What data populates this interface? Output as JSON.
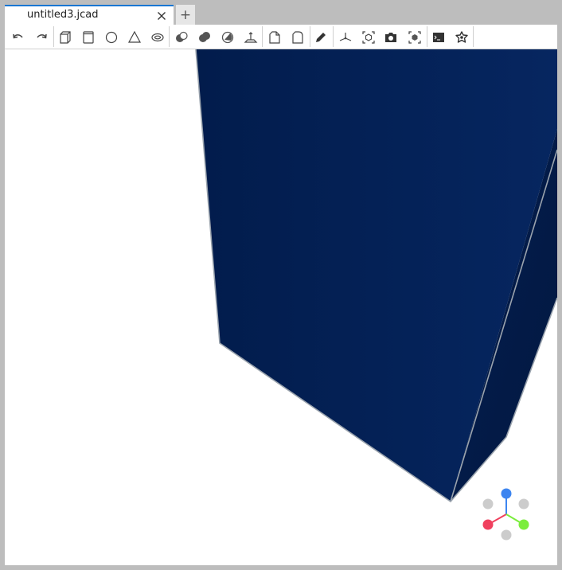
{
  "tabs": [
    {
      "label": "untitled3.jcad",
      "active": true
    }
  ],
  "add_tab_label": "+",
  "toolbar": {
    "buttons": [
      {
        "name": "undo-button",
        "icon": "undo-icon"
      },
      {
        "name": "redo-button",
        "icon": "redo-icon"
      },
      {
        "name": "box-button",
        "icon": "box-icon"
      },
      {
        "name": "cylinder-button",
        "icon": "cylinder-icon"
      },
      {
        "name": "sphere-button",
        "icon": "sphere-icon"
      },
      {
        "name": "cone-button",
        "icon": "cone-icon"
      },
      {
        "name": "torus-button",
        "icon": "torus-icon"
      },
      {
        "name": "cut-button",
        "icon": "cut-icon"
      },
      {
        "name": "union-button",
        "icon": "union-icon"
      },
      {
        "name": "intersection-button",
        "icon": "intersection-icon"
      },
      {
        "name": "extrusion-button",
        "icon": "extrusion-icon"
      },
      {
        "name": "chamfer-button",
        "icon": "chamfer-icon"
      },
      {
        "name": "fillet-button",
        "icon": "fillet-icon"
      },
      {
        "name": "sketch-button",
        "icon": "pencil-icon"
      },
      {
        "name": "axes-button",
        "icon": "axes-icon"
      },
      {
        "name": "explode-button",
        "icon": "explode-icon"
      },
      {
        "name": "screenshot-button",
        "icon": "camera-icon"
      },
      {
        "name": "wireframe-button",
        "icon": "wireframe-icon"
      },
      {
        "name": "console-button",
        "icon": "terminal-icon"
      },
      {
        "name": "settings-button",
        "icon": "flower-icon"
      }
    ]
  },
  "colors": {
    "accent": "#1976d2",
    "solid_dark": "#021a46",
    "solid_light": "#06265c",
    "edge": "#9aa3ad",
    "axis_z": "#3d85f0",
    "axis_x": "#f0405e",
    "axis_y": "#7bed3d",
    "axis_neg": "#cccccc"
  }
}
